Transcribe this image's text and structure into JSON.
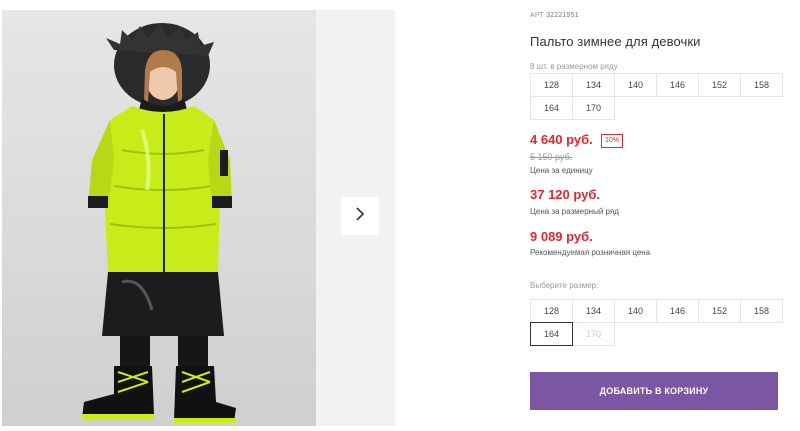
{
  "gallery": {
    "main_photo_alt": "Пальто зимнее для девочки",
    "next_icon": "chevron-right-icon",
    "jacket_color": "#c8ec1a",
    "dark_color": "#1c1c1e"
  },
  "product": {
    "sku_label": "АРТ",
    "sku_value": "32221951",
    "title": "Пальто зимнее для девочки",
    "pack_note": "8 шт. в размерном ряду",
    "pack_sizes": [
      "128",
      "134",
      "140",
      "146",
      "152",
      "158",
      "164",
      "170"
    ],
    "price_unit": "4 640 руб.",
    "discount": "10%",
    "old_price": "5 150 руб.",
    "price_unit_caption": "Цена за единицу",
    "price_set": "37 120 руб.",
    "price_set_caption": "Цена за размерный ряд",
    "price_rrp": "9 089 руб.",
    "price_rrp_caption": "Рекомендуемая розничная цена",
    "choose_size_label": "Выберите размер:",
    "select_sizes": [
      "128",
      "134",
      "140",
      "146",
      "152",
      "158",
      "164",
      "170"
    ],
    "selected_size": "164",
    "disabled_size": "170",
    "add_to_cart_label": "ДОБАВИТЬ В КОРЗИНУ"
  },
  "colors": {
    "accent_purple": "#7b57a3",
    "price_red": "#e3262f"
  }
}
